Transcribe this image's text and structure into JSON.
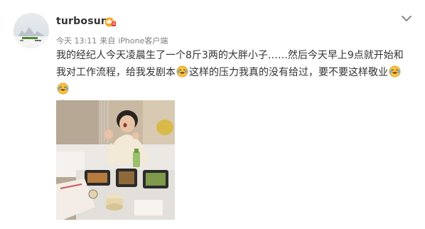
{
  "post": {
    "username": "turbosun",
    "time": "今天 13:11",
    "source_prefix": "来自",
    "source_client": "iPhone客户端",
    "text_part1": "我的经纪人今天凌晨生了一个8斤3两的大胖小子……然后今天早上9点就开始和我对工作流程，给我发剧本",
    "text_part2": "这样的压力我真的没有给过，要不要这样敬业",
    "emoji_name": "laugh-cry-emoji",
    "badge_icon": "vip-crown-icon",
    "menu_icon": "chevron-down-icon"
  },
  "colors": {
    "username": "#333333",
    "meta": "#808080",
    "badge": "#f5a623",
    "emoji_face": "#f7c244"
  }
}
